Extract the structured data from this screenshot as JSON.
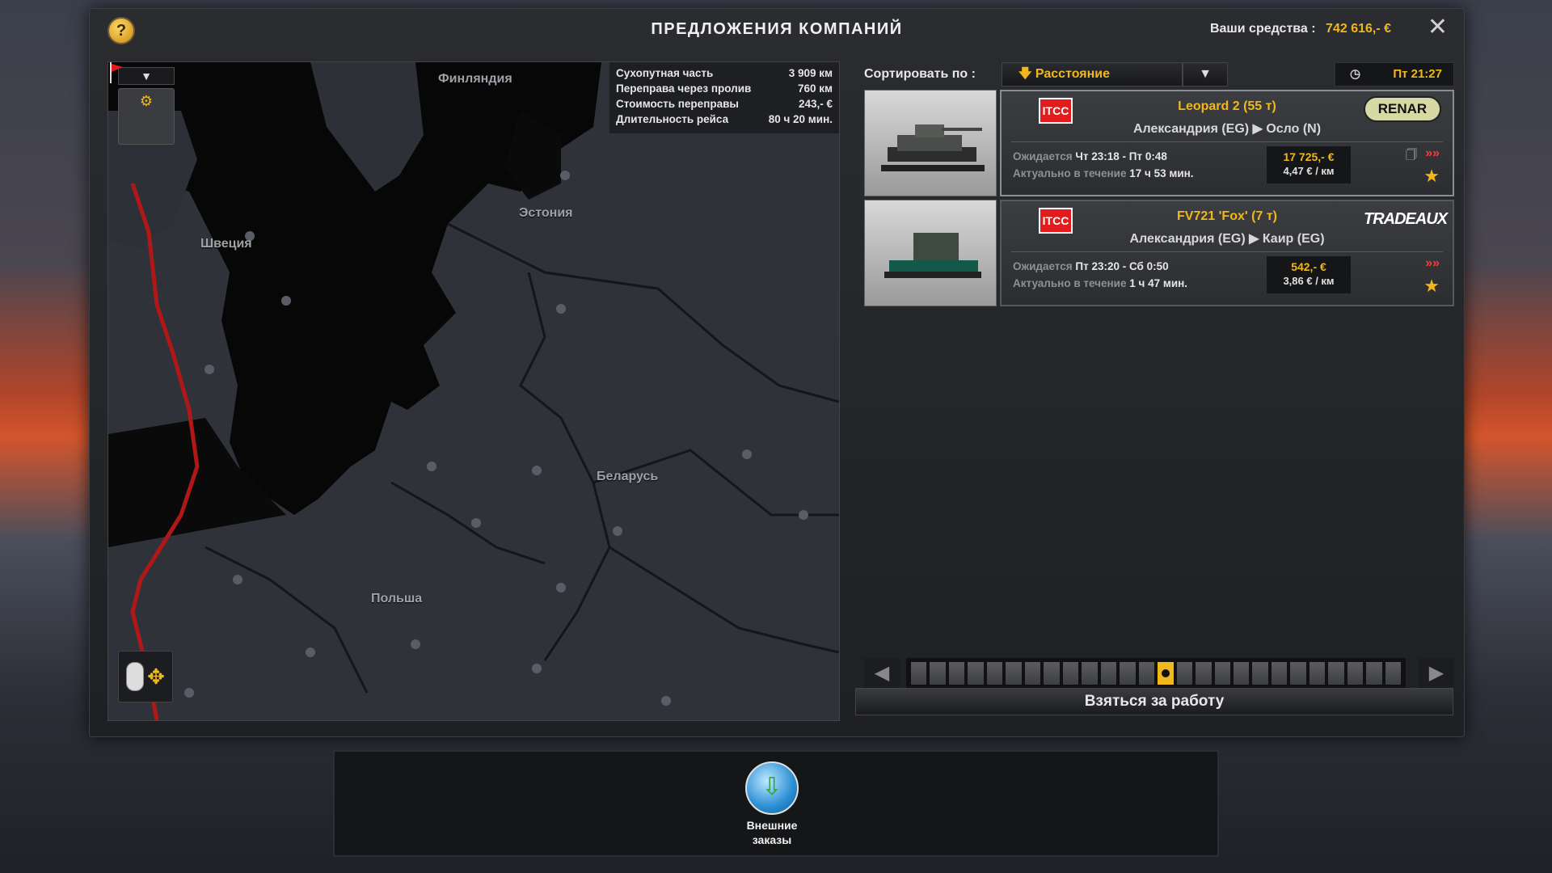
{
  "header": {
    "title": "ПРЕДЛОЖЕНИЯ КОМПАНИЙ",
    "funds_label": "Ваши средства :",
    "funds_value": "742 616,- €",
    "help_icon": "?",
    "close_icon": "✕"
  },
  "map": {
    "labels": [
      "Финляндия",
      "Эстония",
      "Швеция",
      "Беларусь",
      "Польша"
    ],
    "collapse_icon": "chevron-down",
    "info": [
      {
        "label": "Сухопутная часть",
        "value": "3 909 км"
      },
      {
        "label": "Переправа через пролив",
        "value": "760 км"
      },
      {
        "label": "Стоимость переправы",
        "value": "243,- €"
      },
      {
        "label": "Длительность рейса",
        "value": "80 ч 20 мин."
      }
    ]
  },
  "sort": {
    "label": "Сортировать по :",
    "selected": "Расстояние",
    "clock_time": "Пт 21:27"
  },
  "jobs": [
    {
      "origin_logo": "ITCC",
      "cargo": "Leopard 2 (55 т)",
      "route": "Александрия (EG) ▶ Осло (N)",
      "company": "RENAR",
      "expected_label": "Ожидается",
      "expected_value": "Чт 23:18 - Пт 0:48",
      "valid_label": "Актуально в течение",
      "valid_value": "17 ч 53 мин.",
      "price": "17 725,- €",
      "per_km": "4,47 € / км"
    },
    {
      "origin_logo": "ITCC",
      "cargo": "FV721 'Fox' (7 т)",
      "route": "Александрия (EG) ▶ Каир (EG)",
      "company": "TRADEAUX",
      "expected_label": "Ожидается",
      "expected_value": "Пт 23:20 - Сб 0:50",
      "valid_label": "Актуально в течение",
      "valid_value": "1 ч 47 мин.",
      "price": "542,- €",
      "per_km": "3,86 € / км"
    }
  ],
  "pager": {
    "total": 26,
    "active": 13
  },
  "actions": {
    "accept": "Взяться за работу"
  },
  "bottom": {
    "external_orders_line1": "Внешние",
    "external_orders_line2": "заказы"
  },
  "colors": {
    "accent": "#f0b81c",
    "route": "#b01818",
    "logo_red": "#e21c1c"
  }
}
